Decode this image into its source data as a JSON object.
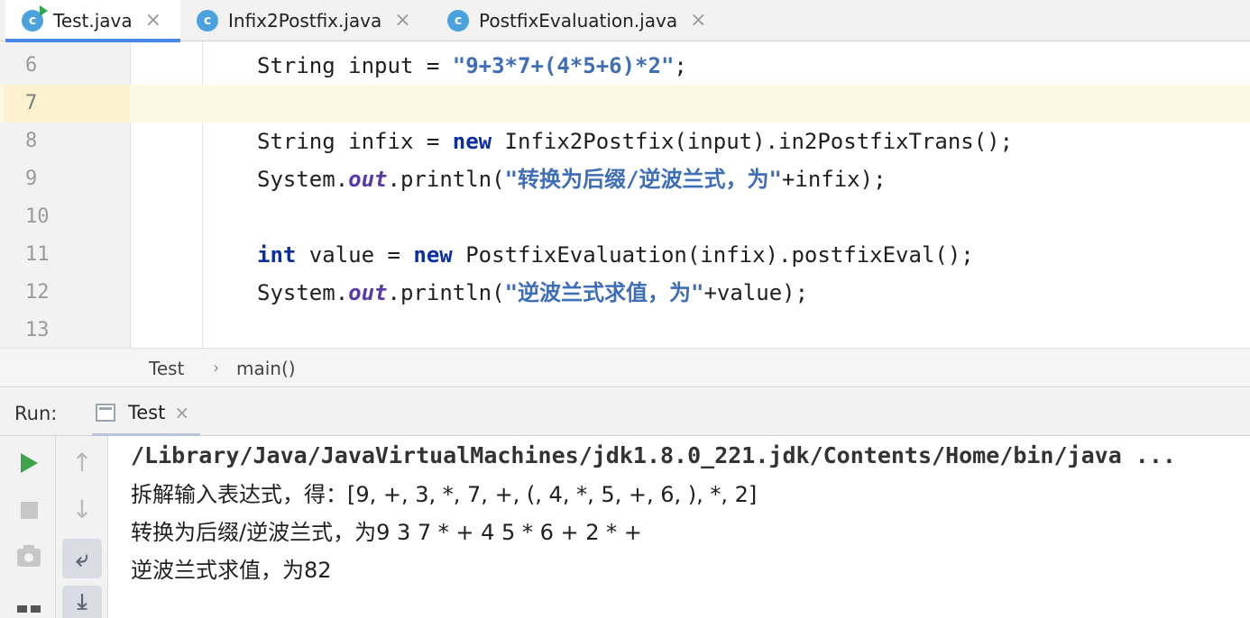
{
  "tabs": [
    {
      "label": "Test.java",
      "icon": "class-c-icon",
      "active": true,
      "runnable": true
    },
    {
      "label": "Infix2Postfix.java",
      "icon": "class-c-icon",
      "active": false
    },
    {
      "label": "PostfixEvaluation.java",
      "icon": "class-c-icon",
      "active": false
    }
  ],
  "editor": {
    "current_line": 7,
    "lines": [
      {
        "num": "6",
        "segments": [
          {
            "t": "String input = ",
            "c": "plain"
          },
          {
            "t": "\"9+3*7+(4*5+6)*2\"",
            "c": "str"
          },
          {
            "t": ";",
            "c": "plain"
          }
        ]
      },
      {
        "num": "7",
        "segments": []
      },
      {
        "num": "8",
        "segments": [
          {
            "t": "String infix = ",
            "c": "plain"
          },
          {
            "t": "new",
            "c": "kw"
          },
          {
            "t": " Infix2Postfix(input).in2PostfixTrans();",
            "c": "plain"
          }
        ]
      },
      {
        "num": "9",
        "segments": [
          {
            "t": "System.",
            "c": "plain"
          },
          {
            "t": "out",
            "c": "fld"
          },
          {
            "t": ".println(",
            "c": "plain"
          },
          {
            "t": "\"转换为后缀/逆波兰式，为\"",
            "c": "str"
          },
          {
            "t": "+infix);",
            "c": "plain"
          }
        ]
      },
      {
        "num": "10",
        "segments": []
      },
      {
        "num": "11",
        "segments": [
          {
            "t": "int",
            "c": "kw"
          },
          {
            "t": " value = ",
            "c": "plain"
          },
          {
            "t": "new",
            "c": "kw"
          },
          {
            "t": " PostfixEvaluation(infix).postfixEval();",
            "c": "plain"
          }
        ]
      },
      {
        "num": "12",
        "segments": [
          {
            "t": "System.",
            "c": "plain"
          },
          {
            "t": "out",
            "c": "fld"
          },
          {
            "t": ".println(",
            "c": "plain"
          },
          {
            "t": "\"逆波兰式求值，为\"",
            "c": "str"
          },
          {
            "t": "+value);",
            "c": "plain"
          }
        ]
      },
      {
        "num": "13",
        "segments": []
      }
    ]
  },
  "breadcrumb": {
    "class": "Test",
    "method": "main()",
    "separator": "›"
  },
  "run_panel": {
    "label": "Run:",
    "tab_label": "Test",
    "console_lines": [
      {
        "text": "/Library/Java/JavaVirtualMachines/jdk1.8.0_221.jdk/Contents/Home/bin/java ...",
        "kind": "cmd"
      },
      {
        "text": "拆解输入表达式，得：[9, +, 3, *, 7, +, (, 4, *, 5, +, 6, ), *, 2]",
        "kind": "out"
      },
      {
        "text": "转换为后缀/逆波兰式，为9 3 7 * + 4 5 * 6 + 2 * +",
        "kind": "out"
      },
      {
        "text": "逆波兰式求值，为82",
        "kind": "out"
      }
    ]
  },
  "colors": {
    "keyword": "#0b2fa3",
    "string": "#3f6eb8",
    "field": "#5a3aa8",
    "current_line": "#fdf8e4",
    "active_tab_underline": "#4a86e8",
    "run_green": "#3fa34d"
  }
}
